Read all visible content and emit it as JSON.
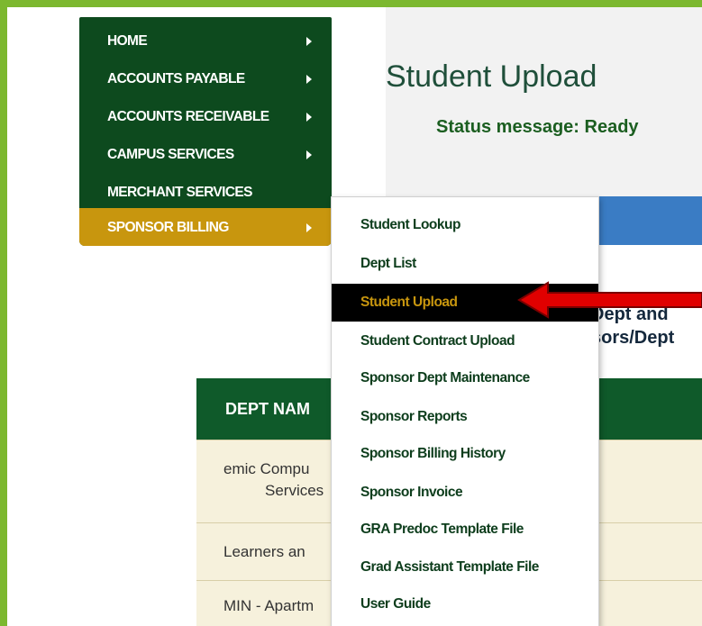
{
  "page": {
    "title": "Student Upload",
    "status": "Status message: Ready"
  },
  "partial_text": {
    "line1": "Dept and",
    "line2": "sors/Dept"
  },
  "table": {
    "header": "DEPT NAM",
    "rows": [
      {
        "line1": "emic Compu",
        "line2": "Services"
      },
      {
        "line1": "Learners an"
      },
      {
        "line1": "MIN - Apartm"
      }
    ]
  },
  "main_menu": {
    "items": [
      {
        "label": "HOME",
        "has_arrow": true
      },
      {
        "label": "ACCOUNTS PAYABLE",
        "has_arrow": true
      },
      {
        "label": "ACCOUNTS RECEIVABLE",
        "has_arrow": true
      },
      {
        "label": "CAMPUS SERVICES",
        "has_arrow": true
      },
      {
        "label": "MERCHANT SERVICES",
        "has_arrow": false
      },
      {
        "label": "SPONSOR BILLING",
        "has_arrow": true,
        "active": true
      }
    ]
  },
  "submenu": {
    "items": [
      {
        "label": "Student Lookup"
      },
      {
        "label": "Dept List"
      },
      {
        "label": "Student Upload",
        "active": true
      },
      {
        "label": "Student Contract Upload"
      },
      {
        "label": "Sponsor Dept Maintenance"
      },
      {
        "label": "Sponsor Reports"
      },
      {
        "label": "Sponsor Billing History"
      },
      {
        "label": "Sponsor Invoice"
      },
      {
        "label": "GRA Predoc Template File"
      },
      {
        "label": "Grad Assistant Template File"
      },
      {
        "label": "User Guide"
      }
    ]
  },
  "colors": {
    "outer_frame": "#7cb82f",
    "menu_bg": "#0d4a1e",
    "menu_active": "#c8960e",
    "submenu_active_bg": "#000000",
    "pointer_arrow": "#e00000"
  }
}
